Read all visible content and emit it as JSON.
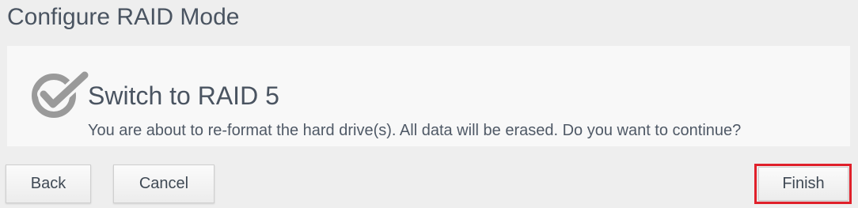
{
  "dialog": {
    "title": "Configure RAID Mode",
    "heading": "Switch to RAID 5",
    "message": "You are about to re-format the hard drive(s). All data will be erased. Do you want to continue?",
    "icon": "checkmark-icon"
  },
  "buttons": {
    "back": "Back",
    "cancel": "Cancel",
    "finish": "Finish"
  },
  "colors": {
    "text": "#4a5461",
    "highlight": "#e0202a",
    "icon": "#9a9a9a"
  }
}
